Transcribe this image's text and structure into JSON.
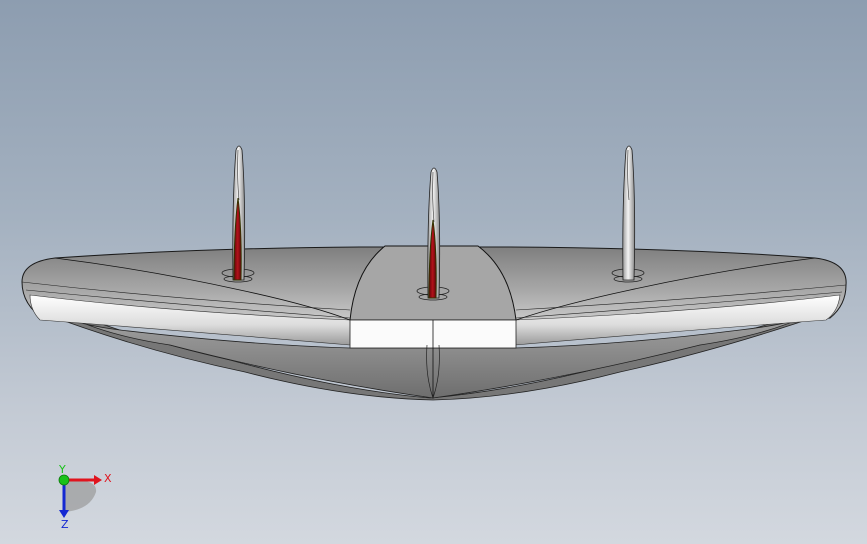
{
  "viewport": {
    "background_top": "#8d9db0",
    "background_bottom": "#d3d8df"
  },
  "model": {
    "body_color": "#8e8e8e",
    "highlight_color": "#ffffff",
    "fin_color": "#d9d9d9",
    "fin_accent_color": "#9b0a10",
    "fin_count": 3
  },
  "triad": {
    "x_label": "X",
    "y_label": "Y",
    "z_label": "Z",
    "x_color": "#e0141e",
    "y_color": "#19c219",
    "z_color": "#1428d2"
  }
}
